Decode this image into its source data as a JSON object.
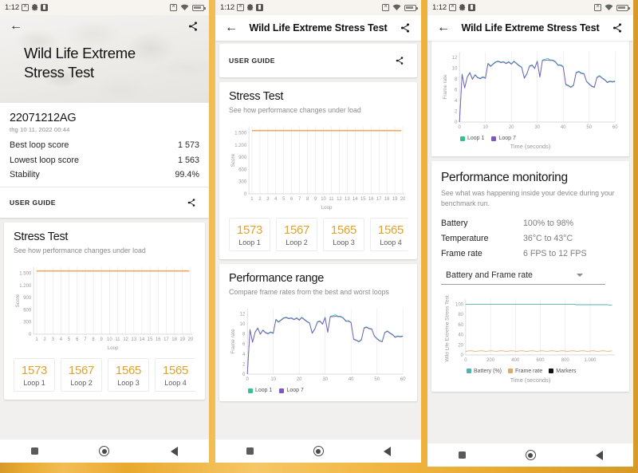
{
  "status_bar": {
    "time": "1:12",
    "left_icons": [
      "sim-icon",
      "gear-icon",
      "app-icon"
    ],
    "right_icons": [
      "no-sim-icon",
      "wifi-icon",
      "battery-icon"
    ]
  },
  "app": {
    "title": "Wild Life Extreme Stress Test",
    "back_icon": "arrow-back-icon",
    "share_icon": "share-icon"
  },
  "panel1": {
    "hero_title": "Wild Life Extreme\nStress Test",
    "result": {
      "device_id": "22071212AG",
      "date": "thg 10 11, 2022 00:44",
      "rows": [
        {
          "label": "Best loop score",
          "value": "1 573"
        },
        {
          "label": "Lowest loop score",
          "value": "1 563"
        },
        {
          "label": "Stability",
          "value": "99.4%"
        }
      ],
      "user_guide": "USER GUIDE"
    },
    "stress": {
      "title": "Stress Test",
      "subtitle": "See how performance changes under load"
    },
    "loops": [
      {
        "score": "1573",
        "name": "Loop 1"
      },
      {
        "score": "1567",
        "name": "Loop 2"
      },
      {
        "score": "1565",
        "name": "Loop 3"
      },
      {
        "score": "1565",
        "name": "Loop 4"
      }
    ]
  },
  "panel2": {
    "user_guide": "USER GUIDE",
    "stress": {
      "title": "Stress Test",
      "subtitle": "See how performance changes under load"
    },
    "loops": [
      {
        "score": "1573",
        "name": "Loop 1"
      },
      {
        "score": "1567",
        "name": "Loop 2"
      },
      {
        "score": "1565",
        "name": "Loop 3"
      },
      {
        "score": "1565",
        "name": "Loop 4"
      }
    ],
    "range": {
      "title": "Performance range",
      "subtitle": "Compare frame rates from the best and worst loops"
    }
  },
  "panel3": {
    "monitoring": {
      "title": "Performance monitoring",
      "subtitle": "See what was happening inside your device during your benchmark run.",
      "rows": [
        {
          "label": "Battery",
          "value": "100% to 98%"
        },
        {
          "label": "Temperature",
          "value": "36°C to 43°C"
        },
        {
          "label": "Frame rate",
          "value": "6 FPS to 12 FPS"
        }
      ],
      "selected_metric": "Battery and Frame rate",
      "caret_icon": "chevron-down-icon"
    }
  },
  "nav_bar": {
    "recents_icon": "square-recents-icon",
    "home_icon": "circle-home-icon",
    "back_icon": "triangle-back-icon"
  },
  "colors": {
    "accent_orange": "#e0a32b",
    "score_line": "#f0a85c",
    "loop1_green": "#34c18e",
    "loop7_purple": "#7e57c2",
    "battery_teal": "#4db6ac",
    "framerate_tan": "#e0a86a",
    "markers_black": "#111111",
    "background": "#eaa93a"
  },
  "chart_data": [
    {
      "id": "stress-test-chart-p1",
      "type": "bar",
      "title": "Stress Test",
      "xlabel": "Loop",
      "ylabel": "Score",
      "categories": [
        "1",
        "2",
        "3",
        "4",
        "5",
        "6",
        "7",
        "8",
        "9",
        "10",
        "11",
        "12",
        "13",
        "14",
        "15",
        "16",
        "17",
        "18",
        "19",
        "20"
      ],
      "values": [
        1573,
        1567,
        1565,
        1565,
        1566,
        1564,
        1563,
        1565,
        1566,
        1564,
        1565,
        1566,
        1565,
        1564,
        1566,
        1565,
        1564,
        1565,
        1566,
        1565
      ],
      "ylim": [
        0,
        1650
      ],
      "yticks": [
        "0",
        "300",
        "600",
        "900",
        "1.200",
        "1.500"
      ],
      "grid": true,
      "legend": "none"
    },
    {
      "id": "stress-test-chart-p2",
      "type": "bar",
      "title": "Stress Test",
      "xlabel": "Loop",
      "ylabel": "Score",
      "categories": [
        "1",
        "2",
        "3",
        "4",
        "5",
        "6",
        "7",
        "8",
        "9",
        "10",
        "11",
        "12",
        "13",
        "14",
        "15",
        "16",
        "17",
        "18",
        "19",
        "20"
      ],
      "values": [
        1573,
        1567,
        1565,
        1565,
        1566,
        1564,
        1563,
        1565,
        1566,
        1564,
        1565,
        1566,
        1565,
        1564,
        1566,
        1565,
        1564,
        1565,
        1566,
        1565
      ],
      "ylim": [
        0,
        1650
      ],
      "yticks": [
        "0",
        "300",
        "600",
        "900",
        "1.200",
        "1.500"
      ],
      "grid": true,
      "legend": "none"
    },
    {
      "id": "performance-range-chart",
      "type": "line",
      "title": "Performance range",
      "xlabel": "Time (seconds)",
      "ylabel": "Frame rate",
      "xlim": [
        0,
        60
      ],
      "ylim": [
        0,
        13
      ],
      "xticks": [
        "0",
        "10",
        "20",
        "30",
        "40",
        "50",
        "60"
      ],
      "yticks": [
        "0",
        "2",
        "4",
        "6",
        "8",
        "10",
        "12"
      ],
      "grid": true,
      "legend_position": "bottom-left",
      "series": [
        {
          "name": "Loop 1",
          "color": "#34c18e",
          "x": [
            0,
            1,
            2,
            3,
            4,
            5,
            6,
            7,
            8,
            9,
            10,
            11,
            12,
            13,
            14,
            15,
            16,
            17,
            18,
            19,
            20,
            21,
            22,
            23,
            24,
            25,
            26,
            27,
            28,
            29,
            30,
            31,
            32,
            33,
            34,
            35,
            36,
            37,
            38,
            39,
            40,
            41,
            42,
            43,
            44,
            45,
            46,
            47,
            48,
            49,
            50,
            51,
            52,
            53,
            54,
            55,
            56,
            57,
            58,
            59,
            60
          ],
          "values": [
            0,
            8.9,
            6.4,
            8.4,
            9.2,
            8.0,
            8.8,
            8.3,
            8.1,
            8.4,
            8.2,
            10.9,
            10.4,
            10.8,
            11.2,
            11.3,
            11.1,
            11.2,
            10.9,
            11.2,
            10.8,
            11.3,
            10.9,
            10.5,
            10.2,
            8.2,
            9.0,
            10.4,
            10.6,
            10.0,
            11.3,
            8.4,
            11.5,
            11.6,
            11.8,
            11.5,
            11.5,
            11.2,
            10.6,
            10.6,
            10.3,
            7.0,
            6.8,
            6.5,
            6.9,
            9.2,
            9.4,
            9.1,
            9.0,
            7.6,
            7.1,
            6.7,
            6.5,
            8.3,
            8.6,
            8.2,
            7.9,
            7.4,
            7.6,
            7.5,
            7.6
          ]
        },
        {
          "name": "Loop 7",
          "color": "#7e57c2",
          "x": [
            0,
            1,
            2,
            3,
            4,
            5,
            6,
            7,
            8,
            9,
            10,
            11,
            12,
            13,
            14,
            15,
            16,
            17,
            18,
            19,
            20,
            21,
            22,
            23,
            24,
            25,
            26,
            27,
            28,
            29,
            30,
            31,
            32,
            33,
            34,
            35,
            36,
            37,
            38,
            39,
            40,
            41,
            42,
            43,
            44,
            45,
            46,
            47,
            48,
            49,
            50,
            51,
            52,
            53,
            54,
            55,
            56,
            57,
            58,
            59,
            60
          ],
          "values": [
            0,
            8.8,
            6.3,
            8.3,
            9.1,
            7.9,
            8.7,
            8.2,
            8.0,
            8.3,
            8.1,
            10.8,
            10.3,
            10.7,
            11.1,
            11.2,
            11.0,
            11.1,
            10.8,
            11.1,
            10.7,
            11.2,
            10.8,
            10.4,
            10.1,
            8.1,
            8.9,
            10.3,
            10.5,
            9.9,
            11.2,
            8.3,
            11.4,
            11.4,
            11.5,
            11.4,
            11.4,
            11.1,
            10.5,
            10.5,
            10.2,
            6.9,
            6.7,
            6.4,
            6.8,
            9.1,
            9.3,
            9.0,
            8.9,
            7.5,
            7.0,
            6.6,
            6.4,
            8.2,
            8.5,
            8.1,
            7.8,
            7.3,
            7.5,
            7.4,
            7.5
          ]
        }
      ]
    },
    {
      "id": "frame-rate-chart-p3",
      "type": "line",
      "title": "Performance range",
      "xlabel": "Time (seconds)",
      "ylabel": "Frame rate",
      "xlim": [
        0,
        60
      ],
      "ylim": [
        0,
        13
      ],
      "xticks": [
        "0",
        "10",
        "20",
        "30",
        "40",
        "50",
        "60"
      ],
      "yticks": [
        "0",
        "2",
        "4",
        "6",
        "8",
        "10",
        "12"
      ],
      "grid": true,
      "legend_position": "bottom-left",
      "legend": [
        "Loop 1",
        "Loop 7"
      ]
    },
    {
      "id": "performance-monitoring-chart",
      "type": "line",
      "xlabel": "Time (seconds)",
      "ylabel": "Wild Life Extreme Stress Test",
      "xlim": [
        0,
        1200
      ],
      "ylim": [
        0,
        110
      ],
      "xticks": [
        "0",
        "200",
        "400",
        "600",
        "800",
        "1.000"
      ],
      "yticks": [
        "0",
        "20",
        "40",
        "60",
        "80",
        "100"
      ],
      "grid": true,
      "legend_position": "bottom-center",
      "series": [
        {
          "name": "Battery (%)",
          "color": "#4db6ac",
          "values": [
            100,
            100,
            100,
            100,
            100,
            100,
            100,
            100,
            99,
            98,
            98
          ]
        },
        {
          "name": "Frame rate",
          "color": "#e0a86a",
          "values": [
            7,
            8,
            7,
            8,
            7,
            8,
            7,
            8,
            7,
            8,
            7
          ]
        },
        {
          "name": "Markers",
          "color": "#111111",
          "values": []
        }
      ]
    }
  ]
}
